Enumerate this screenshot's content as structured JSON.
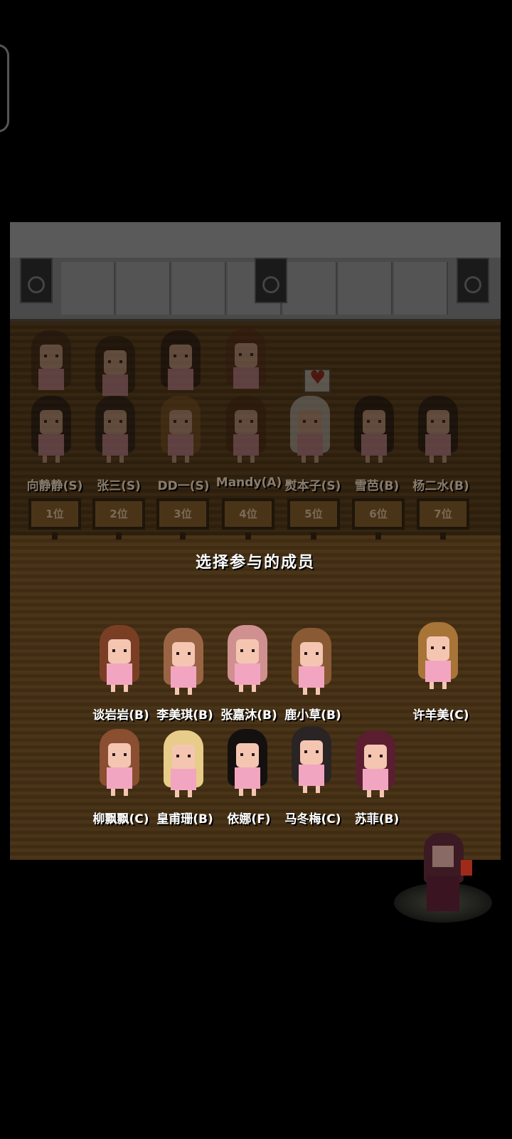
{
  "top_row": [
    {
      "name": "向静静(S)",
      "rank": "1位"
    },
    {
      "name": "张三(S)",
      "rank": "2位"
    },
    {
      "name": "DD一(S)",
      "rank": "3位"
    },
    {
      "name": "Mandy(A)",
      "rank": "4位"
    },
    {
      "name": "熨本子(S)",
      "rank": "5位"
    },
    {
      "name": "雪芭(B)",
      "rank": "6位"
    },
    {
      "name": "杨二水(B)",
      "rank": "7位"
    }
  ],
  "prompt": "选择参与的成员",
  "members_row1": [
    {
      "name": "谈岩岩(B)"
    },
    {
      "name": "李美琪(B)"
    },
    {
      "name": "张嘉沐(B)"
    },
    {
      "name": "鹿小草(B)"
    },
    {
      "name": "许羊美(C)"
    }
  ],
  "members_row2": [
    {
      "name": "柳飘飘(C)"
    },
    {
      "name": "皇甫珊(B)"
    },
    {
      "name": "依娜(F)"
    },
    {
      "name": "马冬梅(C)"
    },
    {
      "name": "苏菲(B)"
    }
  ],
  "colors": {
    "floor": "#4a3418",
    "outfit": "#f2a5c0",
    "heart": "#b02020"
  }
}
